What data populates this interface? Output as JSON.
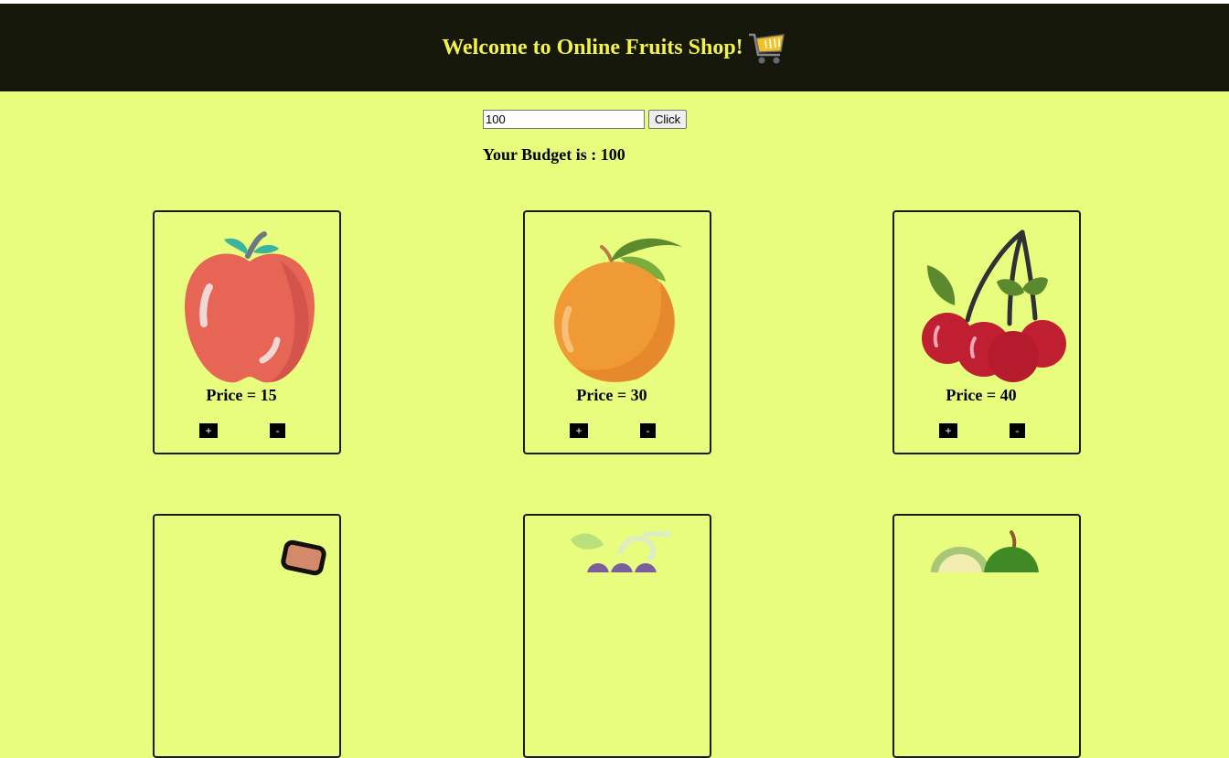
{
  "header": {
    "title": "Welcome to Online Fruits Shop!",
    "icon": "shopping-cart-icon",
    "title_color": "#f1f24a",
    "bg_color": "#16180c"
  },
  "budget": {
    "input_value": "100",
    "button_label": "Click",
    "label": "Your Budget is : ",
    "value": "100"
  },
  "page_bg": "#e8fc7d",
  "products": [
    {
      "name": "apple-icon",
      "price_label": "Price = 15",
      "plus": "+",
      "minus": "-"
    },
    {
      "name": "orange-icon",
      "price_label": "Price = 30",
      "plus": "+",
      "minus": "-"
    },
    {
      "name": "cherry-icon",
      "price_label": "Price = 40",
      "plus": "+",
      "minus": "-"
    },
    {
      "name": "fruit-icon"
    },
    {
      "name": "grapes-icon"
    },
    {
      "name": "avocado-icon"
    }
  ]
}
